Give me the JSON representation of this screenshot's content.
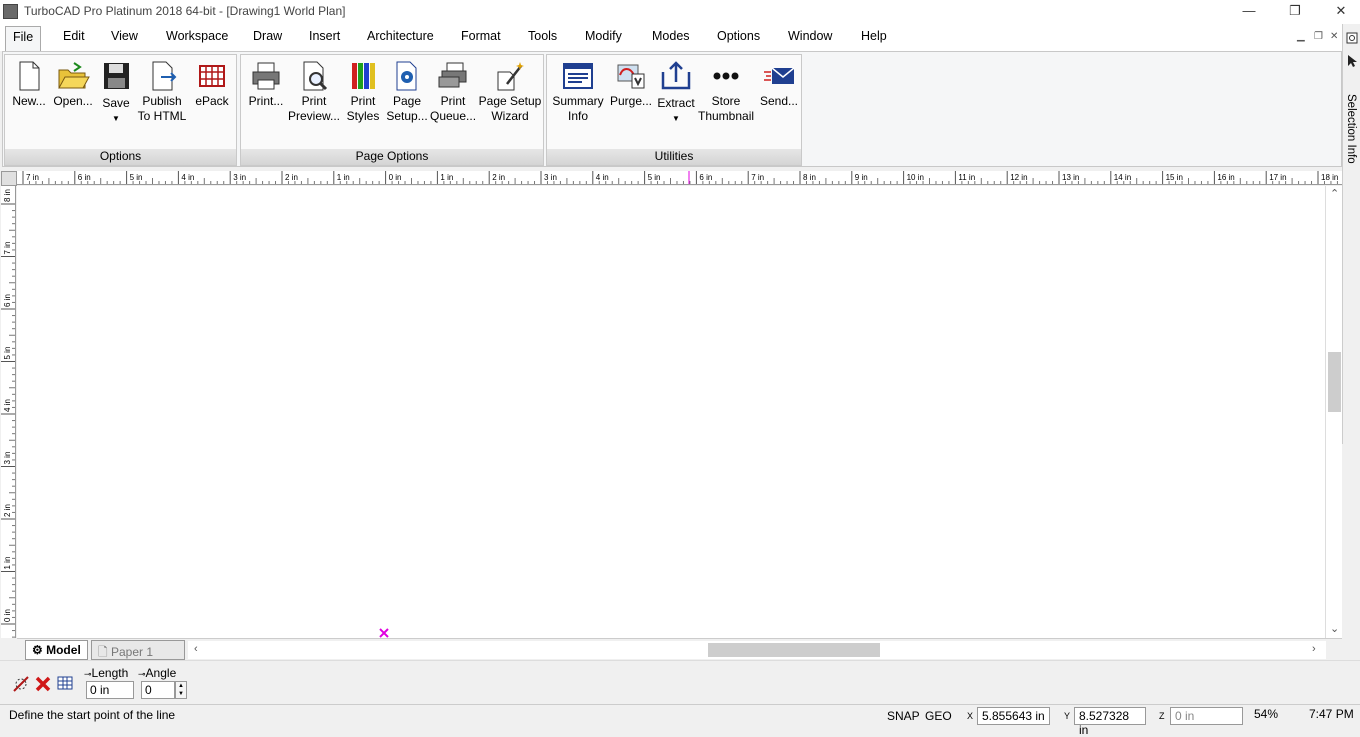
{
  "window": {
    "title": "TurboCAD Pro Platinum 2018 64-bit - [Drawing1 World Plan]",
    "minimize": "—",
    "restore": "❐",
    "close": "✕"
  },
  "menu": [
    "File",
    "Edit",
    "View",
    "Workspace",
    "Draw",
    "Insert",
    "Architecture",
    "Format",
    "Tools",
    "Modify",
    "Modes",
    "Options",
    "Window",
    "Help"
  ],
  "ribbon": {
    "groups": [
      {
        "label": "Options",
        "buttons": [
          "New...",
          "Open...",
          "Save",
          "Publish\nTo HTML",
          "ePack"
        ]
      },
      {
        "label": "Page Options",
        "buttons": [
          "Print...",
          "Print\nPreview...",
          "Print\nStyles",
          "Page\nSetup...",
          "Print\nQueue...",
          "Page Setup\nWizard"
        ]
      },
      {
        "label": "Utilities",
        "buttons": [
          "Summary\nInfo",
          "Purge...",
          "Extract",
          "Store\nThumbnail",
          "Send..."
        ]
      }
    ]
  },
  "side_panel": {
    "tab_label": "Selection Info"
  },
  "ruler": {
    "h_labels": [
      "7 in",
      "6 in",
      "5 in",
      "4 in",
      "3 in",
      "2 in",
      "1 in",
      "0 in",
      "1 in",
      "2 in",
      "3 in",
      "4 in",
      "5 in",
      "6 in",
      "7 in",
      "8 in",
      "9 in",
      "10 in",
      "11 in",
      "12 in",
      "13 in",
      "14 in",
      "15 in",
      "16 in",
      "17 in",
      "18 in"
    ],
    "v_labels": [
      "8 in",
      "7 in",
      "6 in",
      "5 in",
      "4 in",
      "3 in",
      "2 in",
      "1 in",
      "0 in"
    ]
  },
  "sheets": {
    "model": "Model",
    "paper": "Paper 1"
  },
  "inspector": {
    "length_label": "Length",
    "angle_label": "Angle",
    "length_value": "0 in",
    "angle_value": "0"
  },
  "status": {
    "message": "Define the start point of the line",
    "snap": "SNAP",
    "geo": "GEO",
    "x_label": "X",
    "x": "5.855643 in",
    "y_label": "Y",
    "y": "8.527328 in",
    "z_label": "Z",
    "z": "0 in",
    "zoom": "54%",
    "time": "7:47 PM"
  },
  "colors": {
    "cursor_marker": "#e000e0",
    "accent": "#1f5fb0"
  }
}
